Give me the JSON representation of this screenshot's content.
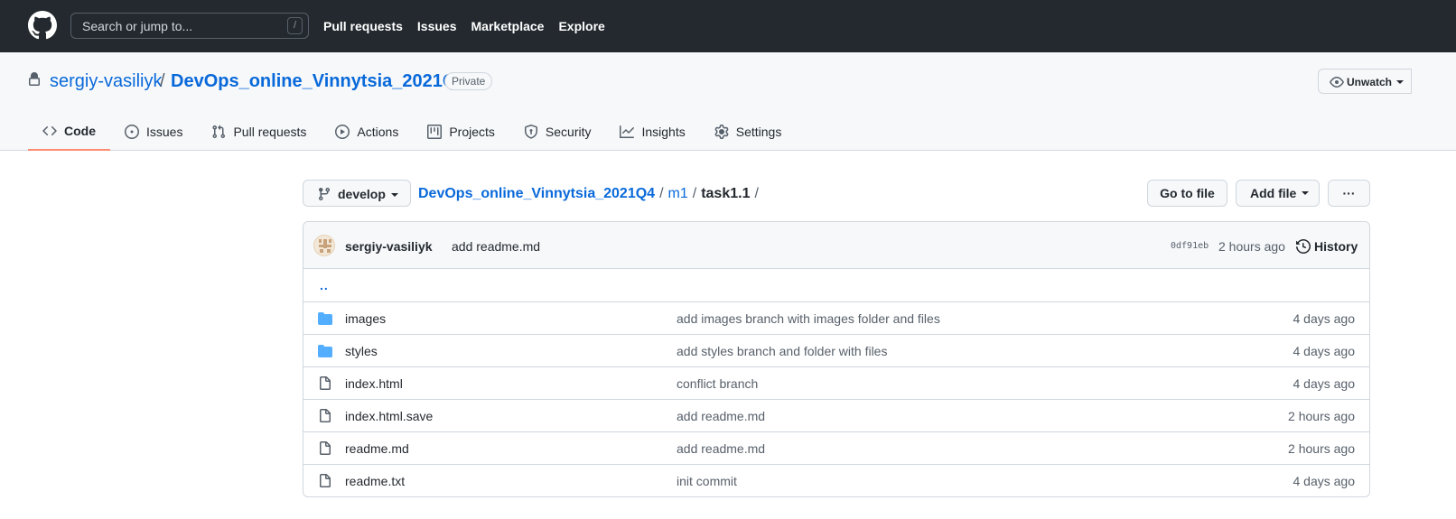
{
  "header": {
    "search_placeholder": "Search or jump to...",
    "slash_key": "/",
    "nav": [
      "Pull requests",
      "Issues",
      "Marketplace",
      "Explore"
    ]
  },
  "repo": {
    "owner": "sergiy-vasiliyk",
    "separator": "/",
    "name": "DevOps_online_Vinnytsia_2021Q4",
    "visibility": "Private",
    "watch_label": "Unwatch"
  },
  "tabs": [
    {
      "label": "Code",
      "icon": "code-icon",
      "active": true
    },
    {
      "label": "Issues",
      "icon": "issue-icon"
    },
    {
      "label": "Pull requests",
      "icon": "pull-request-icon"
    },
    {
      "label": "Actions",
      "icon": "play-icon"
    },
    {
      "label": "Projects",
      "icon": "project-icon"
    },
    {
      "label": "Security",
      "icon": "shield-icon"
    },
    {
      "label": "Insights",
      "icon": "graph-icon"
    },
    {
      "label": "Settings",
      "icon": "gear-icon"
    }
  ],
  "toolbar": {
    "branch": "develop",
    "crumbs": {
      "root": "DevOps_online_Vinnytsia_2021Q4",
      "dir": "m1",
      "current": "task1.1",
      "sep": "/"
    },
    "goto_label": "Go to file",
    "add_file_label": "Add file",
    "more_label": "···"
  },
  "commit": {
    "author": "sergiy-vasiliyk",
    "message": "add readme.md",
    "sha": "0df91eb",
    "time": "2 hours ago",
    "history_label": "History"
  },
  "files": {
    "updir": "..",
    "rows": [
      {
        "name": "images",
        "type": "dir",
        "message": "add images branch with images folder and files",
        "age": "4 days ago"
      },
      {
        "name": "styles",
        "type": "dir",
        "message": "add styles branch and folder with files",
        "age": "4 days ago"
      },
      {
        "name": "index.html",
        "type": "file",
        "message": "conflict branch",
        "age": "4 days ago"
      },
      {
        "name": "index.html.save",
        "type": "file",
        "message": "add readme.md",
        "age": "2 hours ago"
      },
      {
        "name": "readme.md",
        "type": "file",
        "message": "add readme.md",
        "age": "2 hours ago"
      },
      {
        "name": "readme.txt",
        "type": "file",
        "message": "init commit",
        "age": "4 days ago"
      }
    ]
  },
  "colors": {
    "header_bg": "#24292f",
    "link": "#0969da",
    "folder": "#54aeff",
    "tab_underline": "#fd8c73"
  }
}
